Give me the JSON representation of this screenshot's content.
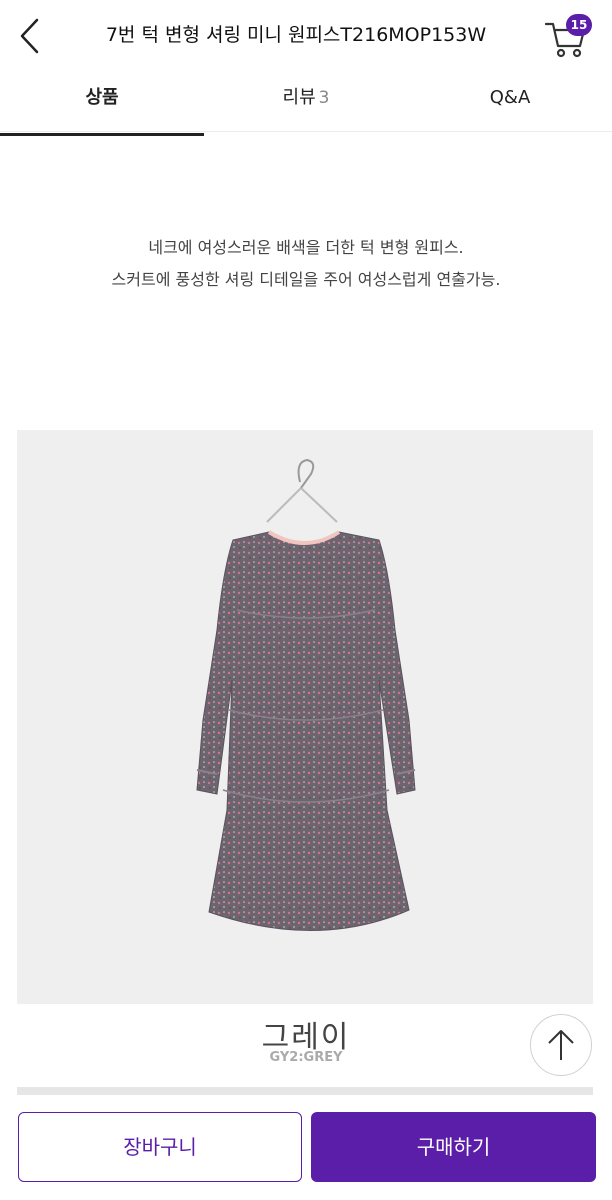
{
  "header": {
    "title": "7번 턱 변형 셔링 미니 원피스T216MOP153W",
    "cart_count": "15",
    "back_icon": "chevron-left-icon",
    "cart_icon": "cart-icon"
  },
  "tabs": [
    {
      "label": "상품",
      "count": "",
      "active": true
    },
    {
      "label": "리뷰",
      "count": "3",
      "active": false
    },
    {
      "label": "Q&A",
      "count": "",
      "active": false
    }
  ],
  "description": {
    "line1": "네크에 여성스러운 배색을 더한 턱 변형 원피스.",
    "line2": "스커트에 풍성한 셔링 디테일을 주어 여성스럽게 연출가능."
  },
  "product": {
    "color_name": "그레이",
    "color_code": "GY2:GREY"
  },
  "actions": {
    "cart_label": "장바구니",
    "buy_label": "구매하기"
  },
  "colors": {
    "accent": "#5a1ea8",
    "image_bg": "#efefef"
  }
}
